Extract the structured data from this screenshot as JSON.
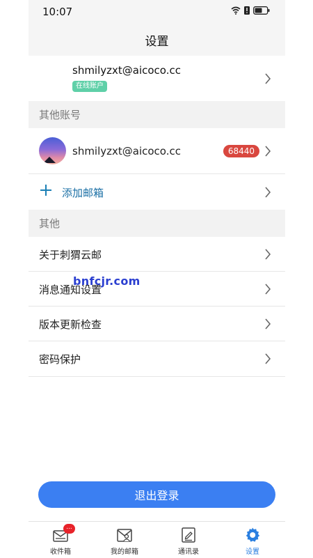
{
  "status_bar": {
    "time": "10:07"
  },
  "header": {
    "title": "设置"
  },
  "current_account": {
    "email": "shmilyzxt@aicoco.cc",
    "badge": "在线账户"
  },
  "other_accounts": {
    "section_title": "其他账号",
    "items": [
      {
        "email": "shmilyzxt@aicoco.cc",
        "unread_count": "68440"
      }
    ],
    "add_label": "添加邮箱"
  },
  "other": {
    "section_title": "其他",
    "items": [
      {
        "label": "关于刺猬云邮"
      },
      {
        "label": "消息通知设置"
      },
      {
        "label": "版本更新检查"
      },
      {
        "label": "密码保护"
      }
    ]
  },
  "logout_label": "退出登录",
  "watermark": "bnfcjr.com",
  "tabs": [
    {
      "label": "收件箱",
      "icon": "inbox-icon",
      "badge": "..."
    },
    {
      "label": "我的邮箱",
      "icon": "mailbox-icon"
    },
    {
      "label": "通讯录",
      "icon": "contacts-icon"
    },
    {
      "label": "设置",
      "icon": "gear-icon",
      "active": true
    }
  ],
  "colors": {
    "accent": "#3b7ff2",
    "badge_red": "#d9473f",
    "online_green": "#5fd0a8",
    "link_blue": "#1a6fa5"
  }
}
